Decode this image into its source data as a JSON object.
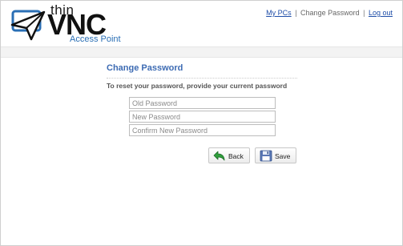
{
  "logo": {
    "thin": "thin",
    "vnc": "VNC",
    "subtitle": "Access Point"
  },
  "nav": {
    "my_pcs": "My PCs",
    "separator": "|",
    "current": "Change Password",
    "logout": "Log out"
  },
  "form": {
    "title": "Change Password",
    "instruction": "To reset your password, provide your current password",
    "old_password_placeholder": "Old Password",
    "new_password_placeholder": "New Password",
    "confirm_password_placeholder": "Confirm New Password",
    "back_label": "Back",
    "save_label": "Save"
  },
  "colors": {
    "accent": "#3d6bb3",
    "link": "#1f4ea8",
    "back_icon": "#2e9e3b",
    "save_icon": "#5a78b5"
  },
  "icons": {
    "back": "back-arrow-icon",
    "save": "floppy-disk-icon",
    "logo": "paper-plane-icon"
  }
}
